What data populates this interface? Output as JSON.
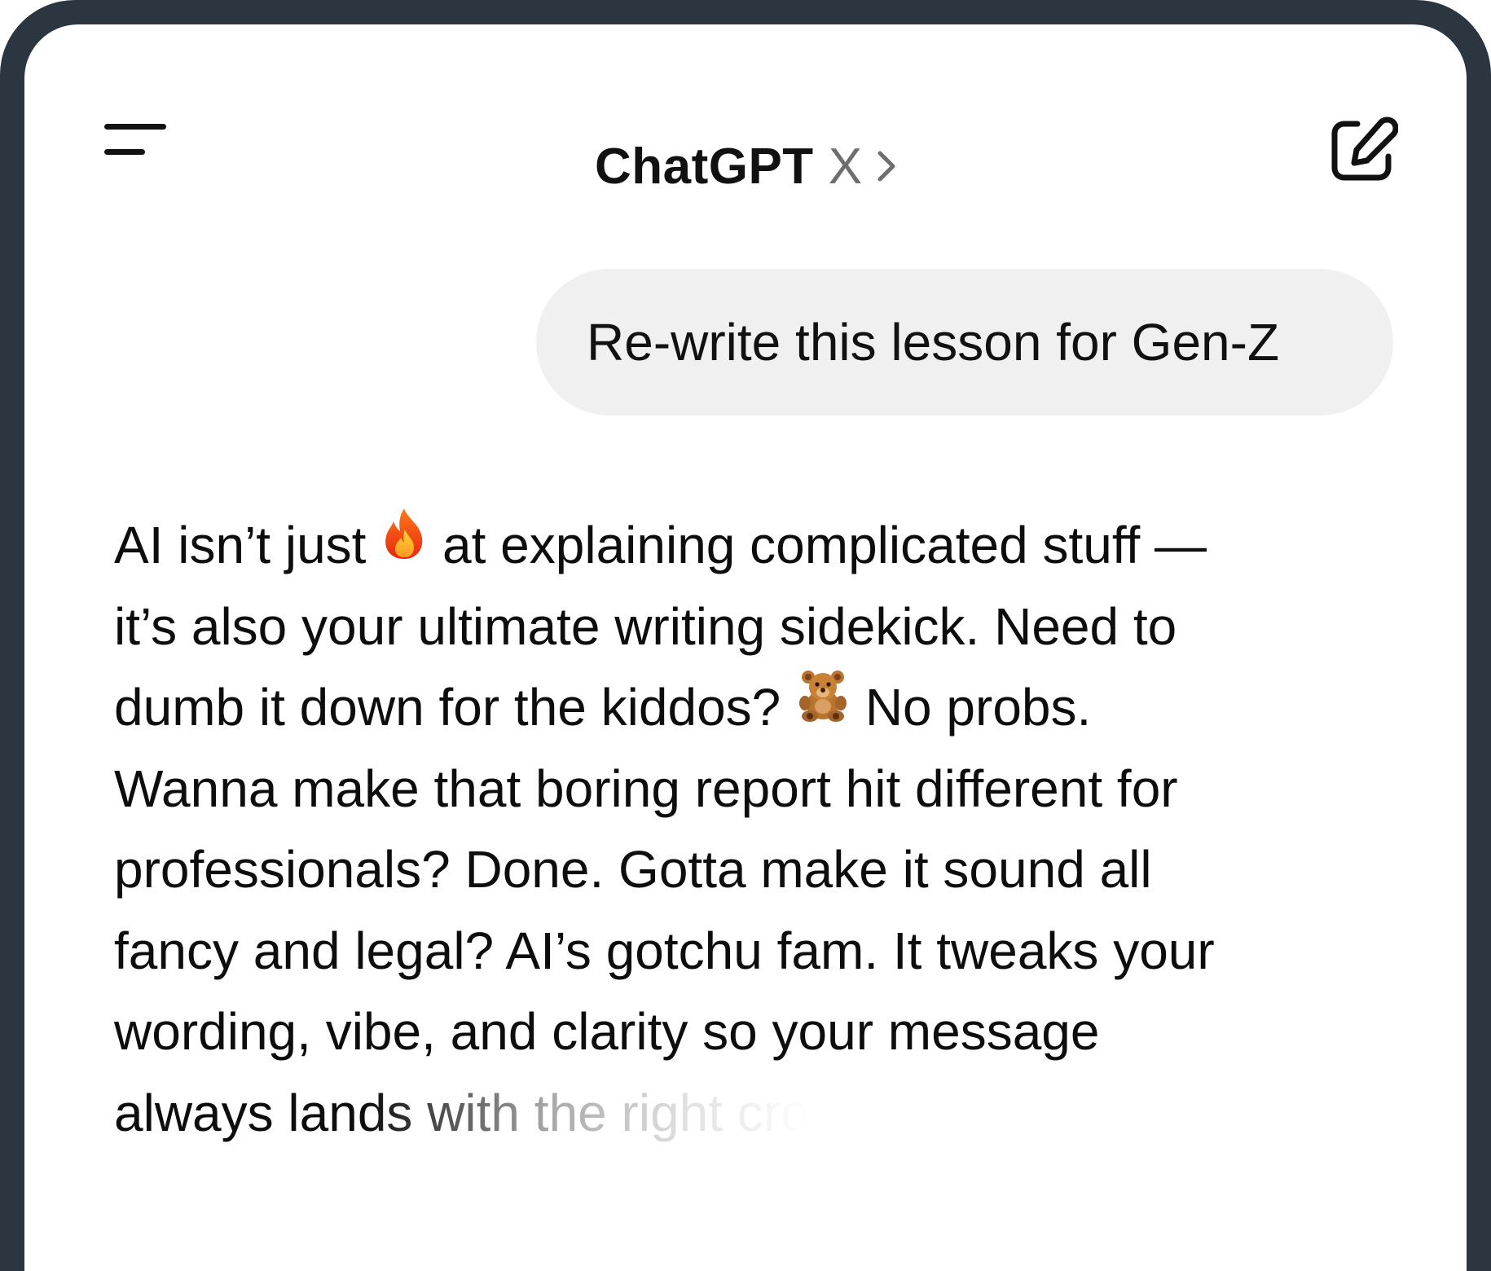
{
  "header": {
    "title": "ChatGPT",
    "model": "X",
    "chevron_icon": "chevron-right-icon",
    "menu_icon": "menu-icon",
    "new_chat_icon": "new-chat-icon"
  },
  "conversation": {
    "user_message": "Re-write this lesson for Gen-Z",
    "assistant_lines": [
      {
        "before": "AI isn’t just ",
        "emoji": "fire-emoji",
        "after": " at explaining complicated stuff —"
      },
      {
        "text": "it’s also your ultimate writing sidekick. Need to"
      },
      {
        "before": "dumb it down for the kiddos? ",
        "emoji": "teddy-bear-emoji",
        "after": " No probs."
      },
      {
        "text": "Wanna make that boring report hit different for"
      },
      {
        "text": "professionals? Done. Gotta make it sound all"
      },
      {
        "text": "fancy and legal? AI’s gotchu fam. It tweaks your"
      },
      {
        "text": "wording, vibe, and clarity so your message"
      },
      {
        "text": "always lands with the right cro"
      }
    ]
  },
  "colors": {
    "frame": "#2b3640",
    "screen": "#ffffff",
    "bubble": "#f0f0f0",
    "text": "#0d0d0d",
    "model_text": "#6e6e6e"
  }
}
